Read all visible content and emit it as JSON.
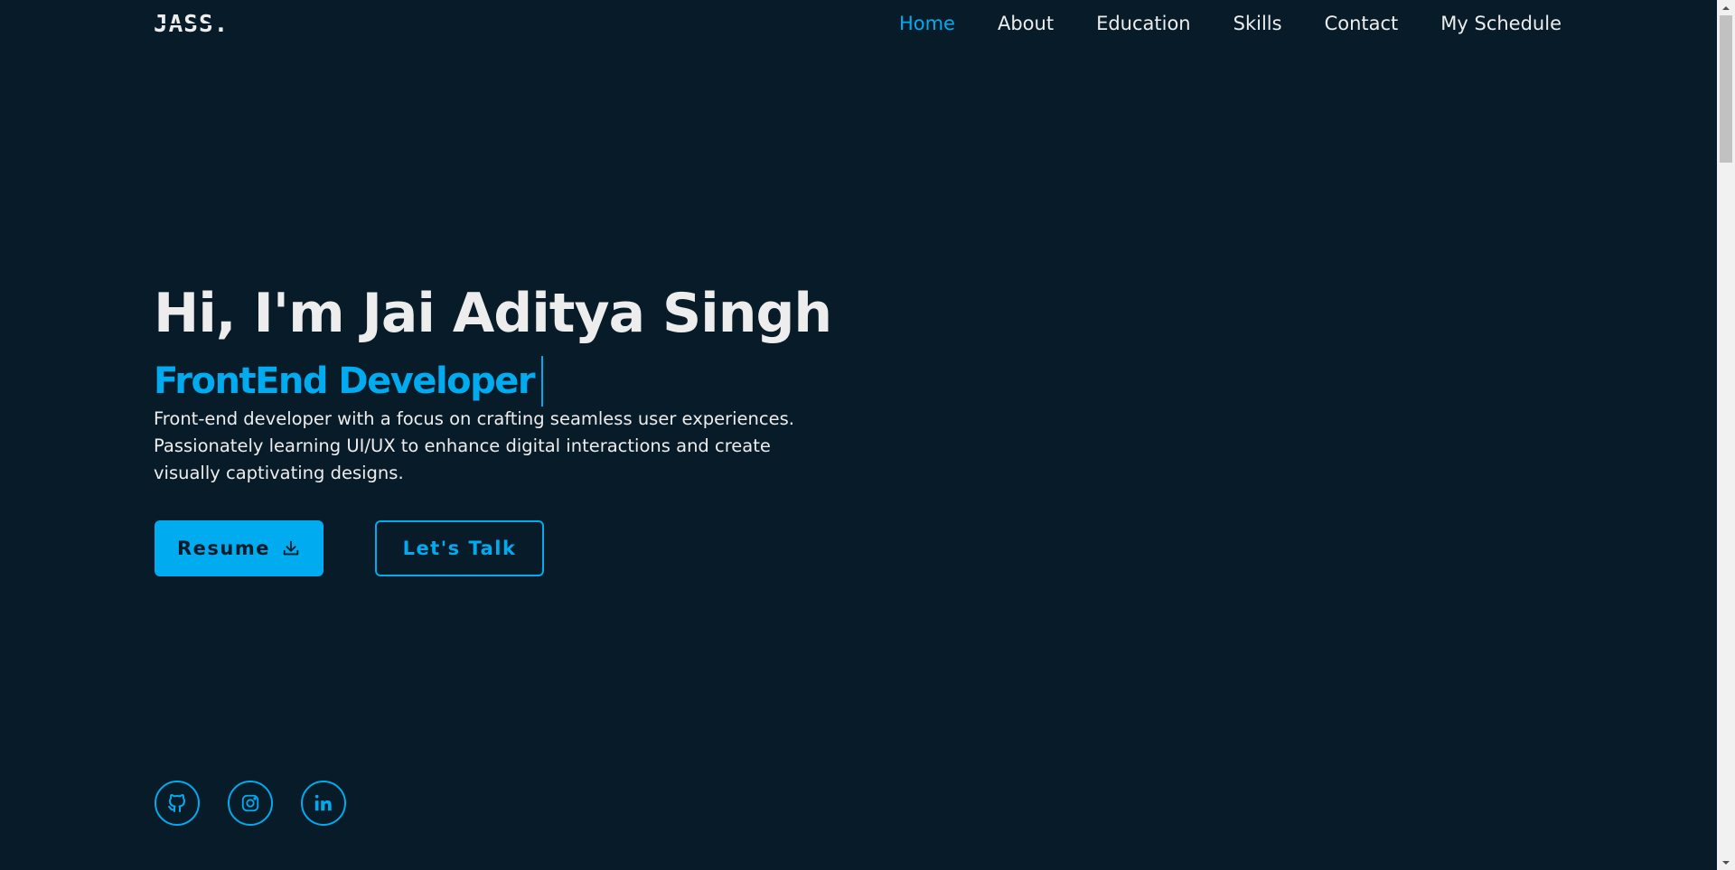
{
  "header": {
    "logo": "JASS."
  },
  "nav": [
    {
      "label": "Home",
      "active": true
    },
    {
      "label": "About",
      "active": false
    },
    {
      "label": "Education",
      "active": false
    },
    {
      "label": "Skills",
      "active": false
    },
    {
      "label": "Contact",
      "active": false
    },
    {
      "label": "My Schedule",
      "active": false
    }
  ],
  "hero": {
    "title": "Hi, I'm Jai Aditya Singh",
    "role": "FrontEnd Developer",
    "description": "Front-end developer with a focus on crafting seamless user experiences. Passionately learning UI/UX to enhance digital interactions and create visually captivating designs."
  },
  "buttons": {
    "resume_label": "Resume",
    "resume_icon": "download-icon",
    "talk_label": "Let's Talk"
  },
  "socials": [
    {
      "icon": "github-icon"
    },
    {
      "icon": "instagram-icon"
    },
    {
      "icon": "linkedin-icon"
    }
  ],
  "colors": {
    "background": "#081b29",
    "accent": "#00abf0",
    "text": "#ededed"
  }
}
